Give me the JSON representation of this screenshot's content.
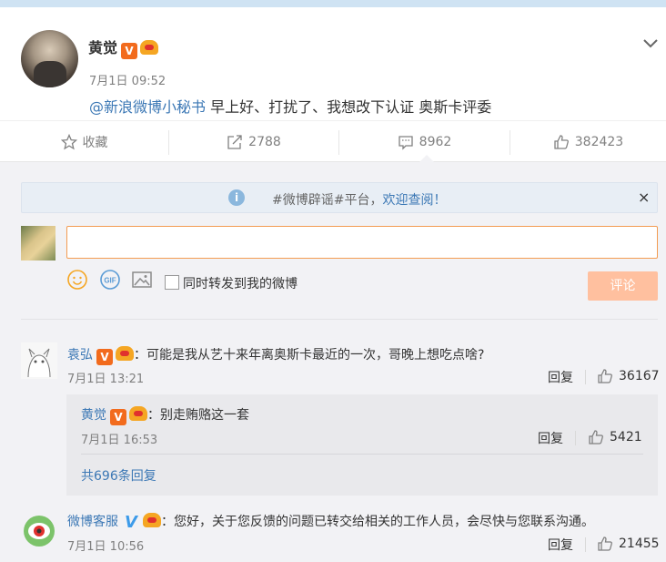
{
  "post": {
    "author": "黄觉",
    "time": "7月1日 09:52",
    "mention": "@新浪微博小秘书",
    "text": " 早上好、打扰了、我想改下认证  奥斯卡评委"
  },
  "actions": {
    "favorite_label": "收藏",
    "repost_count": "2788",
    "comment_count": "8962",
    "like_count": "382423"
  },
  "notice": {
    "prefix": "#微博辟谣#平台，",
    "link": "欢迎查阅！",
    "close": "×"
  },
  "composer": {
    "input_value": "",
    "repost_label": "同时转发到我的微博",
    "submit_label": "评论"
  },
  "comments": [
    {
      "name": "袁弘",
      "text": "：可能是我从艺十来年离奥斯卡最近的一次，哥晚上想吃点啥?",
      "time": "7月1日 13:21",
      "reply_label": "回复",
      "likes": "36167"
    },
    {
      "name": "微博客服",
      "text": "：您好，关于您反馈的问题已转交给相关的工作人员，会尽快与您联系沟通。",
      "time": "7月1日 10:56",
      "reply_label": "回复",
      "likes": "21455"
    }
  ],
  "sub_reply": {
    "name": "黄觉",
    "text": "：别走贿赂这一套",
    "time": "7月1日 16:53",
    "reply_label": "回复",
    "likes": "5421",
    "more_label": "共696条回复"
  },
  "colors": {
    "link": "#3c78b5",
    "vip_orange": "#f26b1d",
    "submit_disabled": "#ffc09f",
    "input_border": "#f39c52"
  }
}
